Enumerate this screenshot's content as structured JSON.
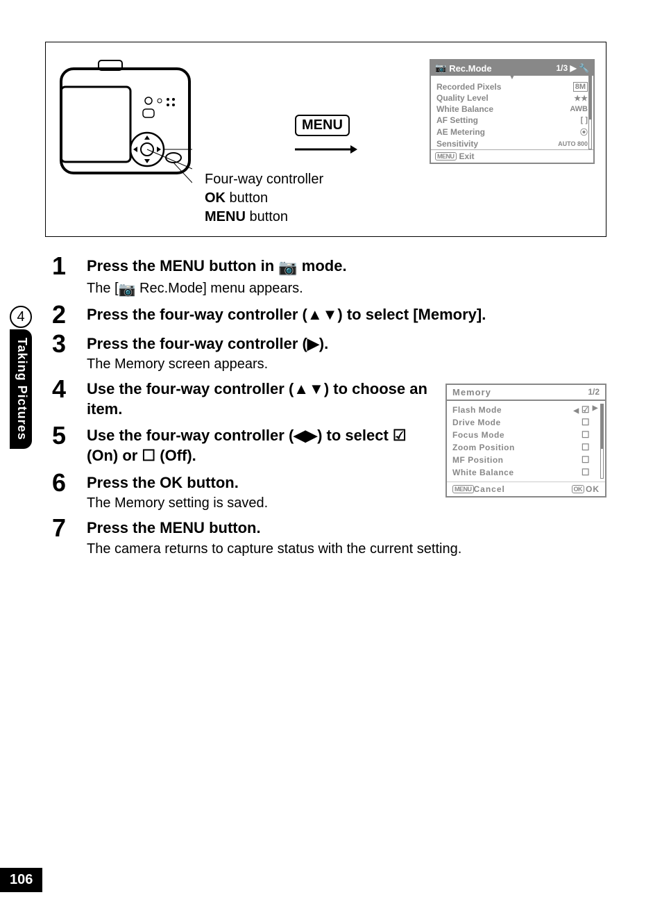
{
  "sideTab": {
    "chapter": "4",
    "label": "Taking Pictures"
  },
  "pageNumber": "106",
  "topPanel": {
    "menuBox": "MENU",
    "labels": {
      "fourWay": "Four-way controller",
      "okButtonPrefix": "OK",
      "okButtonSuffix": " button",
      "menuButtonPrefix": "MENU",
      "menuButtonSuffix": " button"
    },
    "recModeLcd": {
      "title": "Rec.Mode",
      "page": "1/3",
      "rows": [
        {
          "label": "Recorded Pixels",
          "value": "8M"
        },
        {
          "label": "Quality Level",
          "value": "★★"
        },
        {
          "label": "White Balance",
          "value": "AWB"
        },
        {
          "label": "AF Setting",
          "value": "[ ]"
        },
        {
          "label": "AE Metering",
          "value": "⦿"
        },
        {
          "label": "Sensitivity",
          "value": "AUTO 800"
        }
      ],
      "footerBtn": "MENU",
      "footerLabel": "Exit"
    }
  },
  "steps": [
    {
      "n": "1",
      "title_parts": [
        "Press the ",
        "MENU",
        " button in ",
        "📷",
        " mode."
      ],
      "desc_parts": [
        "The [",
        "📷",
        " Rec.Mode] menu appears."
      ]
    },
    {
      "n": "2",
      "title_parts": [
        "Press the four-way controller (▲▼) to select [Memory]."
      ]
    },
    {
      "n": "3",
      "title_parts": [
        "Press the four-way controller (▶)."
      ],
      "desc_parts": [
        "The Memory screen appears."
      ]
    },
    {
      "n": "4",
      "title_parts": [
        "Use the four-way controller (▲▼) to choose an item."
      ]
    },
    {
      "n": "5",
      "title_parts": [
        "Use the four-way controller (◀▶) to select ☑ (On) or ☐ (Off)."
      ]
    },
    {
      "n": "6",
      "title_parts": [
        "Press the ",
        "OK",
        " button."
      ],
      "desc_parts": [
        "The Memory setting is saved."
      ]
    },
    {
      "n": "7",
      "title_parts": [
        "Press the ",
        "MENU",
        " button."
      ],
      "desc_parts": [
        "The camera returns to capture status with the current setting."
      ]
    }
  ],
  "memoryLcd": {
    "title": "Memory",
    "page": "1/2",
    "rows": [
      {
        "label": "Flash Mode",
        "value": "☑",
        "selected": true
      },
      {
        "label": "Drive Mode",
        "value": "☐"
      },
      {
        "label": "Focus Mode",
        "value": "☐"
      },
      {
        "label": "Zoom Position",
        "value": "☐"
      },
      {
        "label": "MF Position",
        "value": "☐"
      },
      {
        "label": "White Balance",
        "value": "☐"
      }
    ],
    "footerLeftBtn": "MENU",
    "footerLeft": "Cancel",
    "footerRightBtn": "OK",
    "footerRight": "OK"
  }
}
